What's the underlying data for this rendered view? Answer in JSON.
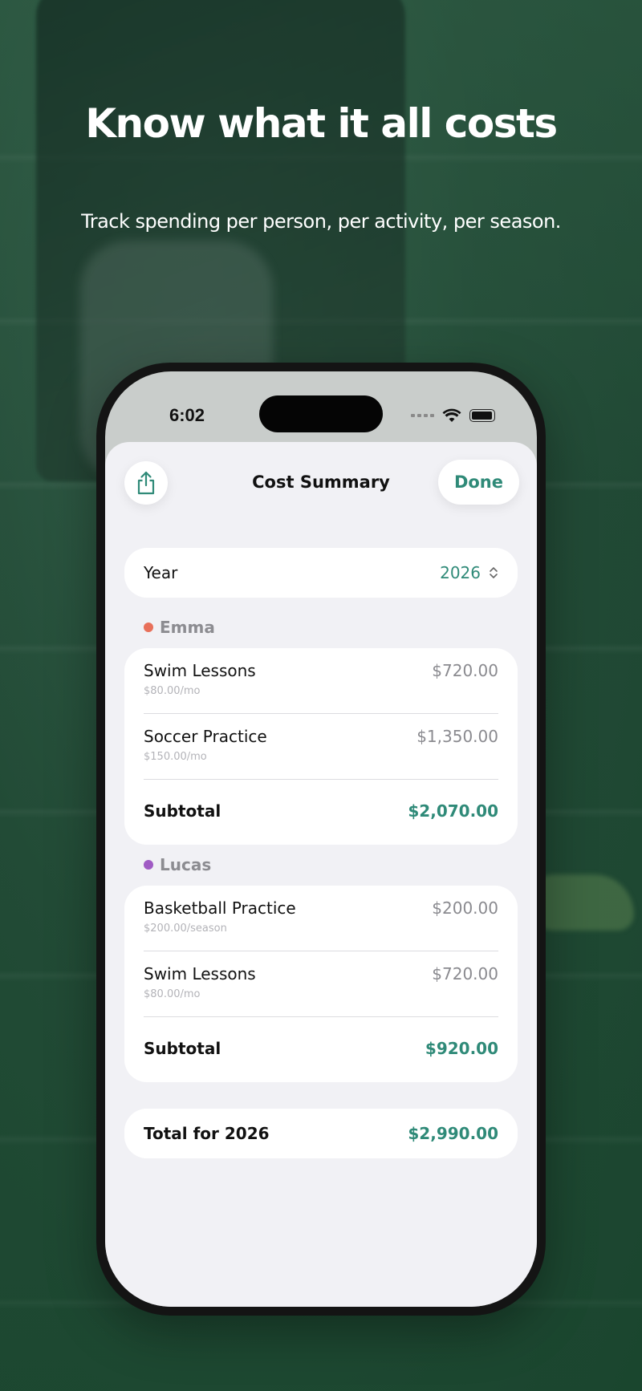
{
  "marketing": {
    "headline": "Know what it all costs",
    "subline": "Track spending per person, per activity, per season."
  },
  "status_bar": {
    "time": "6:02",
    "icons": [
      "cellular-signal-icon",
      "wifi-icon",
      "battery-icon"
    ]
  },
  "sheet": {
    "title": "Cost Summary",
    "share_icon": "share-icon",
    "done_label": "Done"
  },
  "year_picker": {
    "label": "Year",
    "value": "2026"
  },
  "groups": [
    {
      "person": "Emma",
      "color": "#e8705a",
      "items": [
        {
          "name": "Swim Lessons",
          "rate": "$80.00/mo",
          "amount": "$720.00"
        },
        {
          "name": "Soccer Practice",
          "rate": "$150.00/mo",
          "amount": "$1,350.00"
        }
      ],
      "subtotal_label": "Subtotal",
      "subtotal": "$2,070.00"
    },
    {
      "person": "Lucas",
      "color": "#a05bc4",
      "items": [
        {
          "name": "Basketball Practice",
          "rate": "$200.00/season",
          "amount": "$200.00"
        },
        {
          "name": "Swim Lessons",
          "rate": "$80.00/mo",
          "amount": "$720.00"
        }
      ],
      "subtotal_label": "Subtotal",
      "subtotal": "$920.00"
    }
  ],
  "total": {
    "label": "Total for 2026",
    "value": "$2,990.00"
  },
  "colors": {
    "accent": "#2f8a78",
    "sheet_bg": "#f1f1f5"
  }
}
